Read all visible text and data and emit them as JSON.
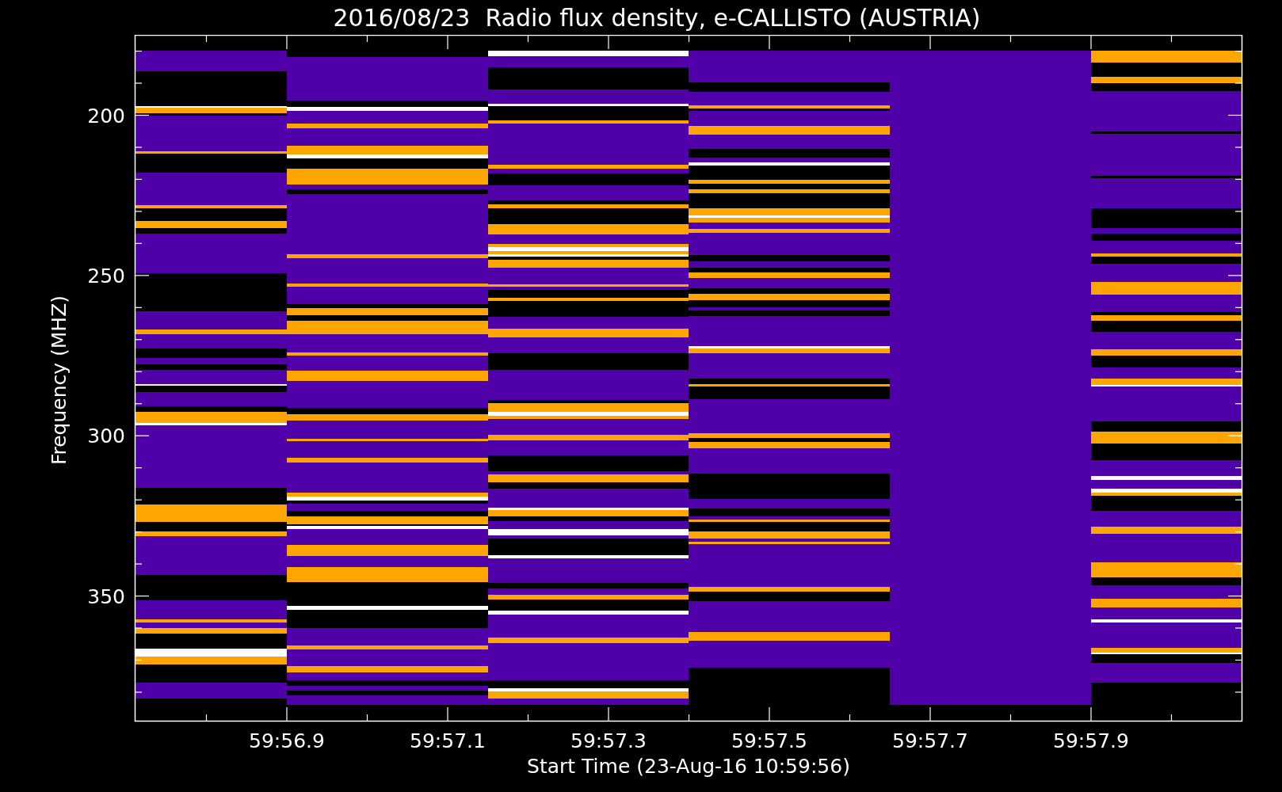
{
  "plot": {
    "title": "2016/08/23  Radio flux density, e-CALLISTO (AUSTRIA)",
    "ylabel": "Frequency (MHZ)",
    "xlabel": "Start Time (23-Aug-16 10:59:56)",
    "yticks": [
      "200",
      "250",
      "300",
      "350"
    ],
    "xticks": [
      "59:56.9",
      "59:57.1",
      "59:57.3",
      "59:57.5",
      "59:57.7",
      "59:57.9"
    ]
  }
}
